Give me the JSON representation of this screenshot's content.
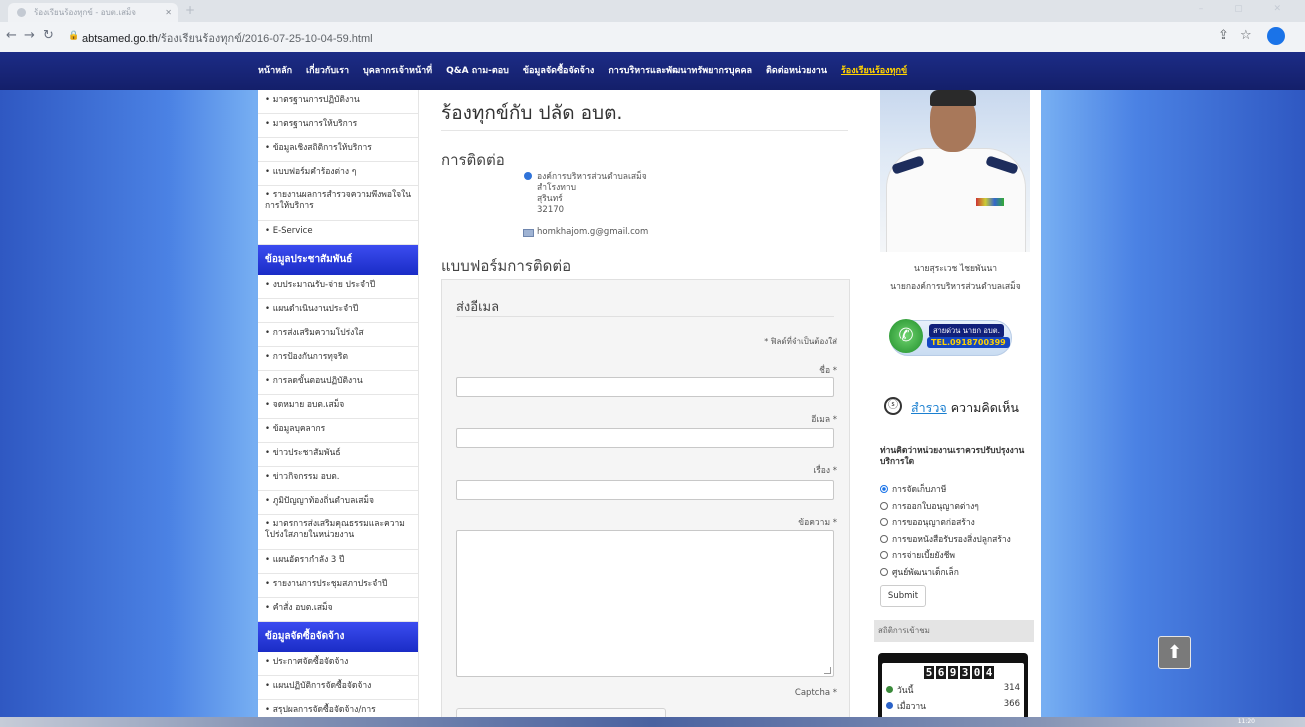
{
  "browser": {
    "tab_title": "ร้องเรียนร้องทุกข์ - อบต.เสม็จ",
    "url_host": "abtsamed.go.th",
    "url_path": "/ร้องเรียนร้องทุกข์/2016-07-25-10-04-59.html"
  },
  "topnav": {
    "items": [
      "หน้าหลัก",
      "เกี่ยวกับเรา",
      "บุคลากรเจ้าหน้าที่",
      "Q&A ถาม-ตอบ",
      "ข้อมูลจัดซื้อจัดจ้าง",
      "การบริหารและพัฒนาทรัพยากรบุคคล",
      "ติดต่อหน่วยงาน",
      "ร้องเรียนร้องทุกข์"
    ],
    "active_index": 7
  },
  "sidebar": {
    "group1": [
      "• มาตรฐานการปฏิบัติงาน",
      "• มาตรฐานการให้บริการ",
      "• ข้อมูลเชิงสถิติการให้บริการ",
      "• แบบฟอร์มคำร้องต่าง ๆ",
      "• รายงานผลการสำรวจความพึงพอใจในการให้บริการ",
      "• E-Service"
    ],
    "head2": "ข้อมูลประชาสัมพันธ์",
    "group2": [
      "• งบประมาณรับ-จ่าย ประจำปี",
      "• แผนดำเนินงานประจำปี",
      "• การส่งเสริมความโปร่งใส",
      "• การป้องกันการทุจริต",
      "• การลดขั้นตอนปฏิบัติงาน",
      "• จดหมาย อบต.เสม็จ",
      "• ข้อมูลบุคลากร",
      "• ข่าวประชาสัมพันธ์",
      "• ข่าวกิจกรรม อบต.",
      "• ภูมิปัญญาท้องถิ่นตำบลเสม็จ",
      "• มาตรการส่งเสริมคุณธรรมและความโปร่งใสภายในหน่วยงาน",
      "• แผนอัตรากำลัง 3 ปี",
      "• รายงานการประชุมสภาประจำปี",
      "• คำสั่ง อบต.เสม็จ"
    ],
    "head3": "ข้อมูลจัดซื้อจัดจ้าง",
    "group3": [
      "• ประกาศจัดซื้อจัดจ้าง",
      "• แผนปฏิบัติการจัดซื้อจัดจ้าง",
      "• สรุปผลการจัดซื้อจัดจ้าง/การ"
    ]
  },
  "content": {
    "title": "ร้องทุกข์กับ ปลัด อบต.",
    "contact_heading": "การติดต่อ",
    "address": [
      "องค์การบริหารส่วนตำบลเสม็จ",
      "สำโรงทาบ",
      "สุรินทร์",
      "32170"
    ],
    "email": "homkhajom.g@gmail.com",
    "form_heading": "แบบฟอร์มการติดต่อ",
    "form": {
      "title": "ส่งอีเมล",
      "required_note": "* ฟิลด์ที่จำเป็นต้องใส่",
      "name_label": "ชื่อ *",
      "email_label": "อีเมล *",
      "subject_label": "เรื่อง *",
      "message_label": "ข้อความ *",
      "captcha_label": "Captcha *"
    }
  },
  "right": {
    "person_name": "นายสุระเวช ไชยพันนา",
    "person_title": "นายกองค์การบริหารส่วนตำบลเสม็จ",
    "hotline_label": "สายด่วน นายก อบต.",
    "hotline_tel": "TEL.0918700399",
    "poll_title_accent": "สำรวจ",
    "poll_title_rest": " ความคิดเห็น",
    "poll_question": "ท่านคิดว่าหน่วยงานเราควรปรับปรุงงานบริการใด",
    "poll_options": [
      "การจัดเก็บภาษี",
      "การออกใบอนุญาตต่างๆ",
      "การขออนุญาตก่อสร้าง",
      "การขอหนังสือรับรองสิ่งปลูกสร้าง",
      "การจ่ายเบี้ยยังชีพ",
      "ศูนย์พัฒนาเด็กเล็ก"
    ],
    "poll_selected_index": 0,
    "submit_label": "Submit",
    "stats_heading": "สถิติการเข้าชม",
    "counter_digits": [
      "5",
      "6",
      "9",
      "3",
      "0",
      "4"
    ],
    "stats": [
      {
        "label": "วันนี้",
        "value": "314"
      },
      {
        "label": "เมื่อวาน",
        "value": "366"
      }
    ]
  },
  "taskbar": {
    "time": "11:20"
  }
}
